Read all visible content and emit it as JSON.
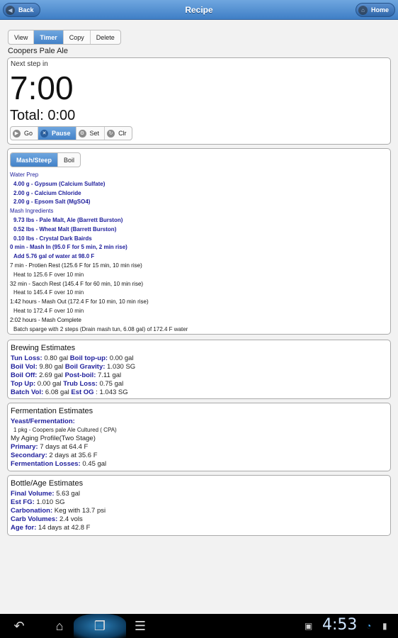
{
  "header": {
    "title": "Recipe",
    "back_label": "Back",
    "home_label": "Home"
  },
  "tabs": [
    "View",
    "Timer",
    "Copy",
    "Delete"
  ],
  "recipe_name": "Coopers Pale Ale",
  "timer": {
    "next_step_label": "Next step in",
    "time": "7:00",
    "total": "Total: 0:00",
    "controls": [
      "Go",
      "Pause",
      "Set",
      "Clr"
    ]
  },
  "step_tabs": [
    "Mash/Steep",
    "Boil"
  ],
  "steps": {
    "water_prep_title": "Water Prep",
    "water_prep": [
      "4.00 g - Gypsum (Calcium Sulfate)",
      "2.00 g - Calcium Chloride",
      "2.00 g - Epsom Salt (MgSO4)"
    ],
    "mash_ingredients_title": "Mash Ingredients",
    "mash_ingredients": [
      "9.73 lbs - Pale Malt, Ale (Barrett Burston)",
      "0.52 lbs - Wheat Malt (Barrett Burston)",
      "0.10 lbs - Crystal Dark Bairds"
    ],
    "mash_in_title": "0 min - Mash In (95.0 F for 5 min, 2 min rise)",
    "mash_in_detail": "Add 5.76 gal of water at 98.0 F",
    "rests": [
      {
        "title": "7 min - Protien Rest (125.6 F for 15 min, 10 min rise)",
        "detail": "Heat to 125.6 F over 10 min"
      },
      {
        "title": "32 min - Sacch Rest (145.4 F for 60 min, 10 min rise)",
        "detail": "Heat to 145.4 F over 10 min"
      },
      {
        "title": "1:42 hours - Mash Out (172.4 F for 10 min, 10 min rise)",
        "detail": "Heat to 172.4 F over 10 min"
      },
      {
        "title": "2:02 hours - Mash Complete",
        "detail": "Batch sparge with 2 steps (Drain mash tun, 6.08 gal) of 172.4 F water"
      }
    ]
  },
  "brewing": {
    "title": "Brewing Estimates",
    "tun_loss_k": "Tun Loss:",
    "tun_loss_v": " 0.80 gal ",
    "boil_topup_k": "Boil top-up:",
    "boil_topup_v": " 0.00 gal",
    "boil_vol_k": "Boil Vol:",
    "boil_vol_v": " 9.80 gal ",
    "boil_grav_k": "Boil Gravity:",
    "boil_grav_v": " 1.030 SG",
    "boil_off_k": "Boil Off:",
    "boil_off_v": " 2.69 gal ",
    "post_boil_k": "Post-boil:",
    "post_boil_v": " 7.11 gal",
    "top_up_k": "Top Up:",
    "top_up_v": " 0.00 gal ",
    "trub_k": "Trub Loss:",
    "trub_v": " 0.75 gal",
    "batch_k": "Batch Vol:",
    "batch_v": " 6.08 gal ",
    "og_k": "Est OG",
    "og_v": " : 1.043 SG"
  },
  "fermentation": {
    "title": "Fermentation Estimates",
    "yeast_k": "Yeast/Fermentation:",
    "yeast_v": "1 pkg - Coopers pale Ale Cultured ( CPA)",
    "profile": "My Aging Profile(Two Stage)",
    "primary_k": "Primary:",
    "primary_v": " 7 days at 64.4 F",
    "secondary_k": "Secondary:",
    "secondary_v": " 2 days at 35.6 F",
    "losses_k": "Fermentation Losses:",
    "losses_v": " 0.45 gal"
  },
  "bottle": {
    "title": "Bottle/Age Estimates",
    "final_k": "Final Volume:",
    "final_v": " 5.63 gal",
    "fg_k": "Est FG:",
    "fg_v": " 1.010 SG",
    "carb_k": "Carbonation:",
    "carb_v": " Keg with 13.7 psi",
    "vols_k": "Carb Volumes:",
    "vols_v": " 2.4 vols",
    "age_k": "Age for:",
    "age_v": " 14 days at 42.8 F"
  },
  "status_bar": {
    "clock": "4:53"
  }
}
